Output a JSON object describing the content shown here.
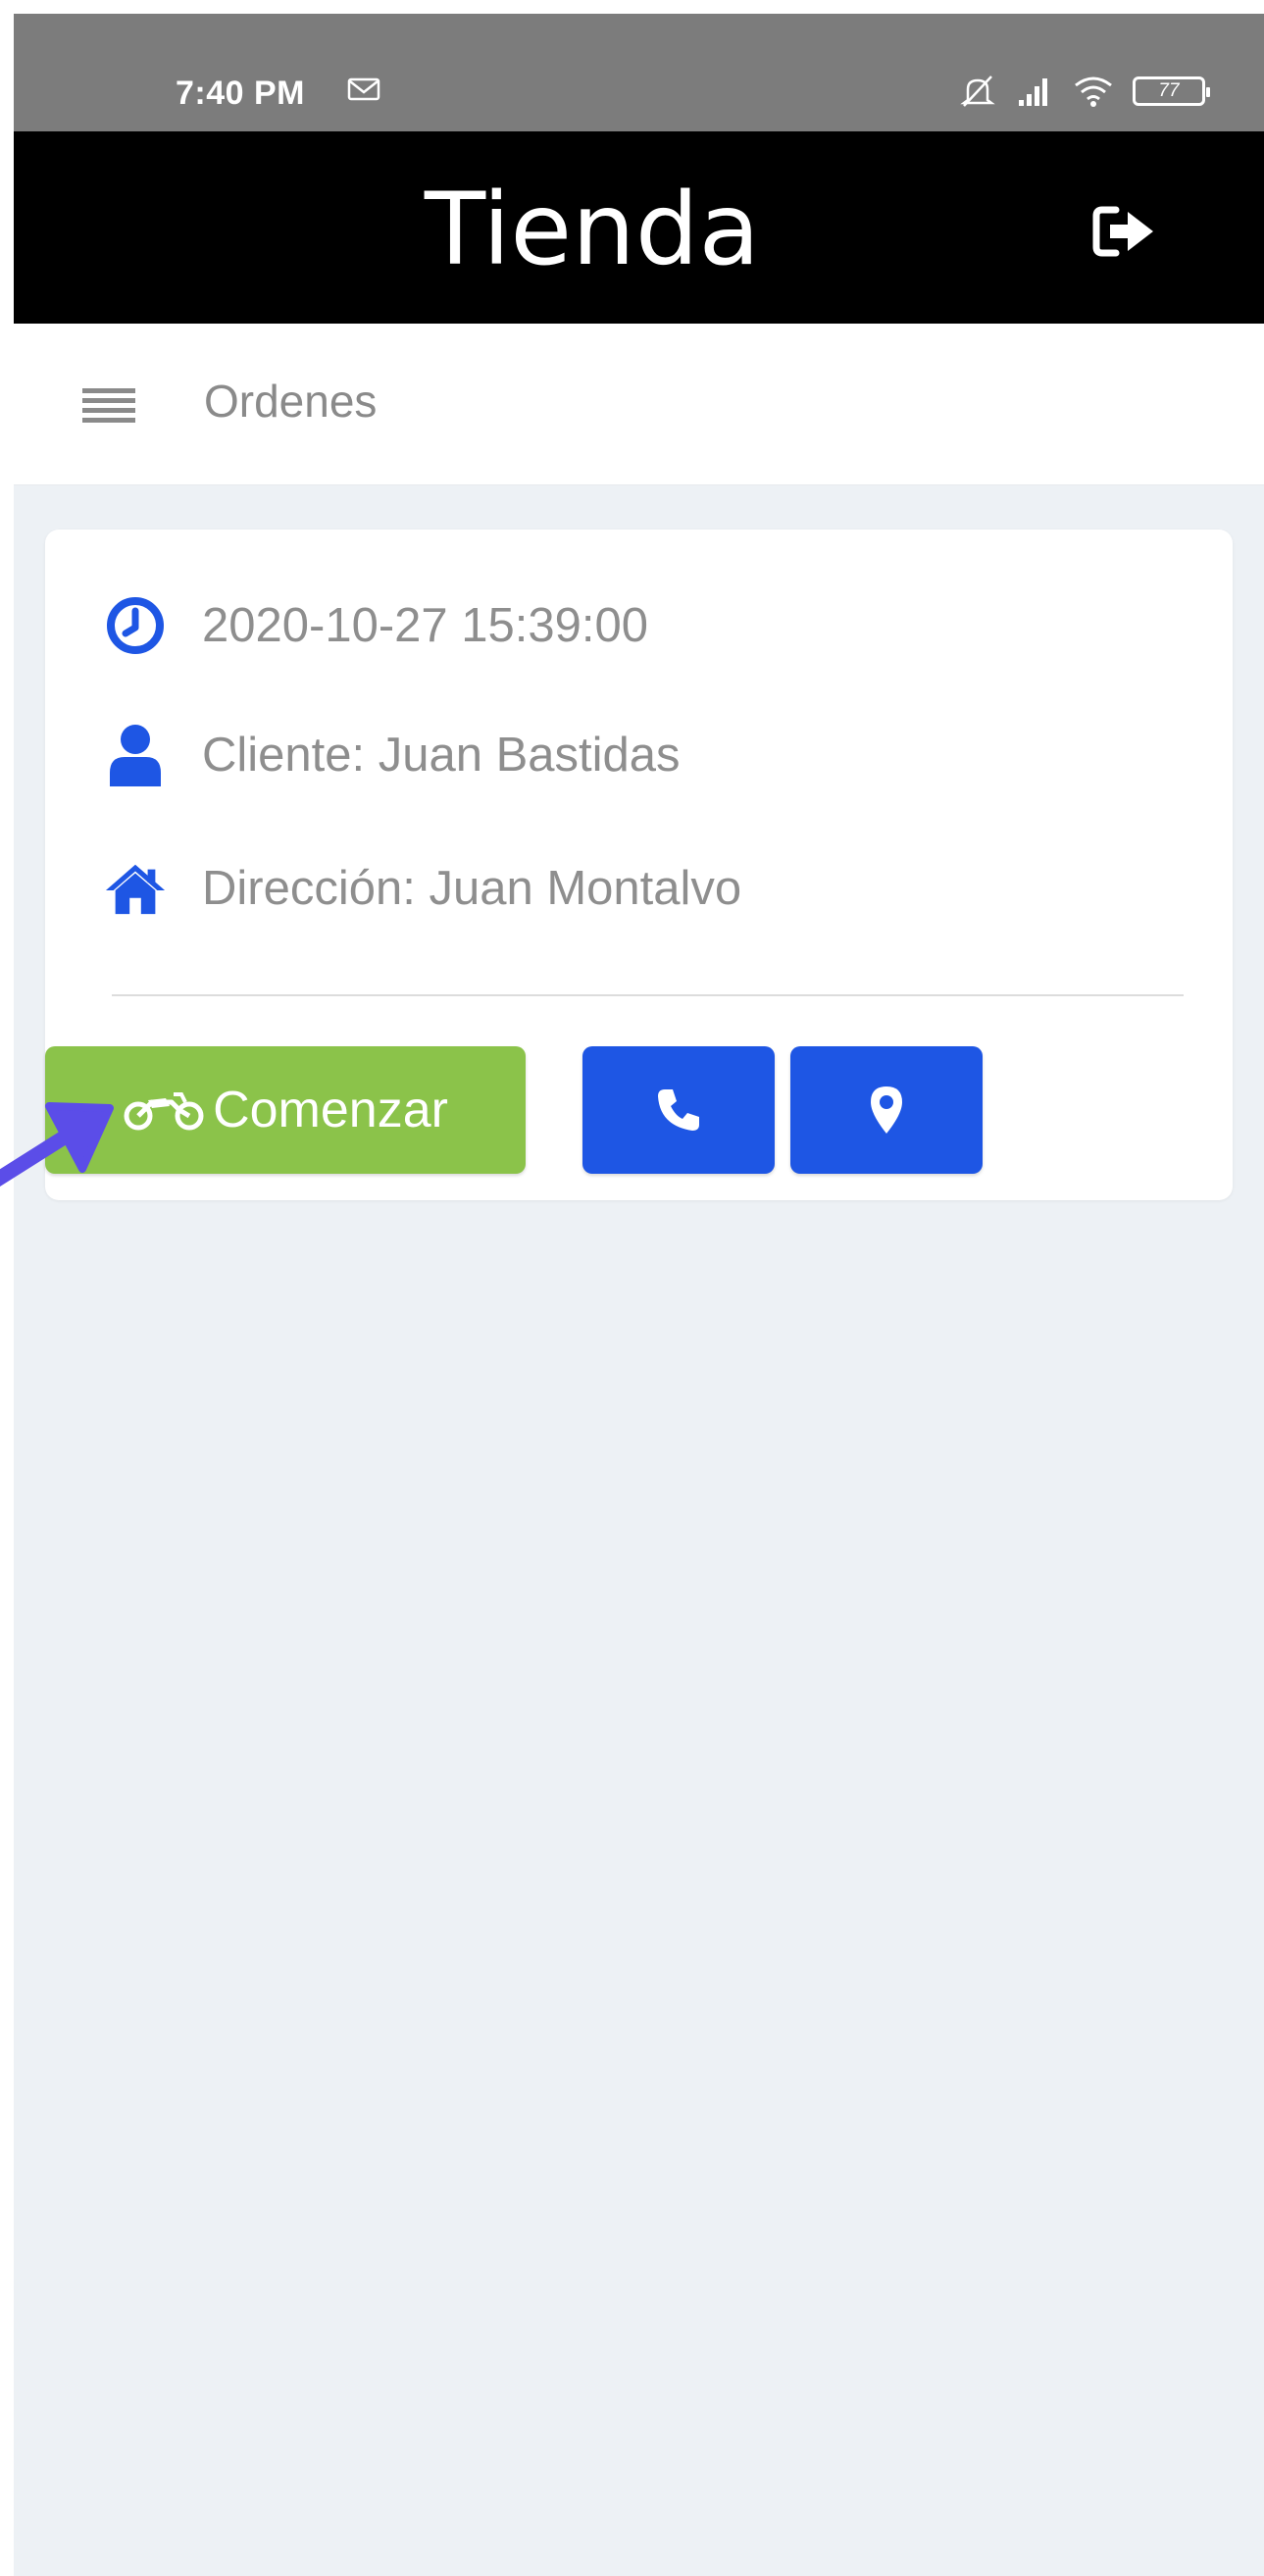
{
  "status_bar": {
    "time": "7:40 PM",
    "battery": "77",
    "icons": [
      "mail-icon",
      "mute-icon",
      "signal-icon",
      "wifi-icon",
      "battery-icon"
    ]
  },
  "header": {
    "title": "Tienda",
    "logout_icon": "sign-out-icon"
  },
  "subheader": {
    "menu_icon": "menu-icon",
    "title": "Ordenes"
  },
  "order": {
    "datetime": "2020-10-27 15:39:00",
    "client": "Cliente: Juan Bastidas",
    "address": "Dirección: Juan Montalvo",
    "start_label": "Comenzar",
    "start_icon": "motorcycle-icon",
    "call_icon": "phone-icon",
    "map_icon": "map-marker-icon"
  },
  "colors": {
    "header_bg": "#000000",
    "status_bar_bg": "#7c7c7c",
    "accent_blue": "#1e56e4",
    "start_green": "#8bc34a",
    "page_bg": "#edf1f5",
    "annotation_arrow": "#5b4de8"
  }
}
